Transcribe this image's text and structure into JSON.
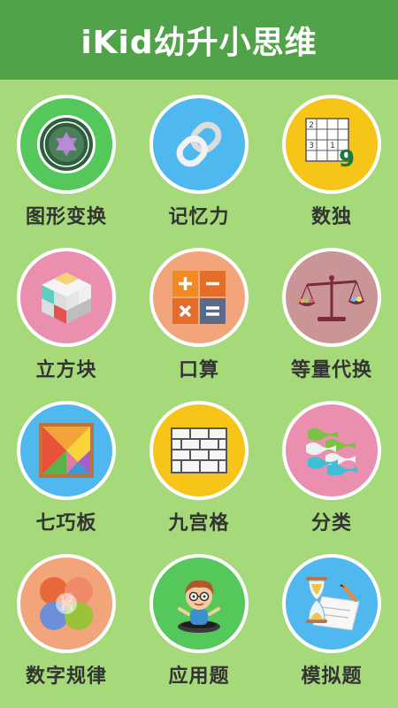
{
  "app": {
    "title": "iKid幼升小思维"
  },
  "colors": {
    "header": "#51a34a",
    "background": "#a6d97a"
  },
  "tiles": [
    {
      "label": "图形变换",
      "icon": "star-of-david-badge-icon",
      "bg": "#55c85b"
    },
    {
      "label": "记忆力",
      "icon": "chain-link-icon",
      "bg": "#4fb8ee"
    },
    {
      "label": "数独",
      "icon": "sudoku-grid-icon",
      "bg": "#f6c517",
      "digits": [
        "2",
        "3",
        "1",
        "9"
      ]
    },
    {
      "label": "立方块",
      "icon": "cube-icon",
      "bg": "#ea8fb0"
    },
    {
      "label": "口算",
      "icon": "calculator-icon",
      "bg": "#f2a57b"
    },
    {
      "label": "等量代换",
      "icon": "balance-scale-icon",
      "bg": "#c99596"
    },
    {
      "label": "七巧板",
      "icon": "tangram-icon",
      "bg": "#4fb8ee"
    },
    {
      "label": "九宫格",
      "icon": "brick-wall-icon",
      "bg": "#f6c517"
    },
    {
      "label": "分类",
      "icon": "ribbons-icon",
      "bg": "#ea8fb0"
    },
    {
      "label": "数字规律",
      "icon": "four-circles-icon",
      "bg": "#f2a57b",
      "digits": [
        "1",
        "2",
        "4",
        "3"
      ]
    },
    {
      "label": "应用题",
      "icon": "boy-in-hole-icon",
      "bg": "#55c85b"
    },
    {
      "label": "模拟题",
      "icon": "hourglass-paper-icon",
      "bg": "#4fb8ee"
    }
  ]
}
